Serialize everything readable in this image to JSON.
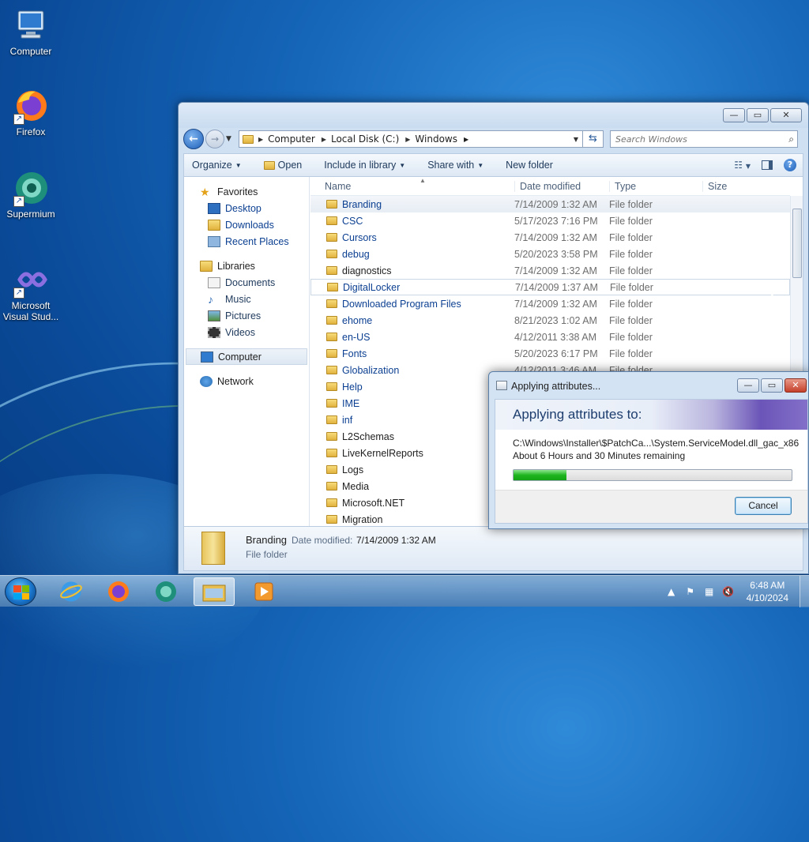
{
  "desktop": {
    "icons": [
      {
        "label": "Computer",
        "icon": "computer-icon"
      },
      {
        "label": "Firefox",
        "icon": "firefox-icon"
      },
      {
        "label": "Supermium",
        "icon": "supermium-icon"
      },
      {
        "label": "Microsoft Visual Stud...",
        "icon": "visual-studio-icon"
      }
    ]
  },
  "explorer": {
    "window_buttons": {
      "minimize": "—",
      "maximize": "▭",
      "close": "✕"
    },
    "breadcrumbs": [
      "Computer",
      "Local Disk (C:)",
      "Windows"
    ],
    "search_placeholder": "Search Windows",
    "toolbar": {
      "organize": "Organize",
      "open": "Open",
      "include_in_library": "Include in library",
      "share_with": "Share with",
      "new_folder": "New folder"
    },
    "nav": {
      "favorites": "Favorites",
      "desktop": "Desktop",
      "downloads": "Downloads",
      "recent_places": "Recent Places",
      "libraries": "Libraries",
      "documents": "Documents",
      "music": "Music",
      "pictures": "Pictures",
      "videos": "Videos",
      "computer": "Computer",
      "network": "Network"
    },
    "columns": {
      "name": "Name",
      "date_modified": "Date modified",
      "type": "Type",
      "size": "Size"
    },
    "files": [
      {
        "name": "Branding",
        "date": "7/14/2009 1:32 AM",
        "type": "File folder"
      },
      {
        "name": "CSC",
        "date": "5/17/2023 7:16 PM",
        "type": "File folder"
      },
      {
        "name": "Cursors",
        "date": "7/14/2009 1:32 AM",
        "type": "File folder"
      },
      {
        "name": "debug",
        "date": "5/20/2023 3:58 PM",
        "type": "File folder"
      },
      {
        "name": "diagnostics",
        "date": "7/14/2009 1:32 AM",
        "type": "File folder"
      },
      {
        "name": "DigitalLocker",
        "date": "7/14/2009 1:37 AM",
        "type": "File folder"
      },
      {
        "name": "Downloaded Program Files",
        "date": "7/14/2009 1:32 AM",
        "type": "File folder"
      },
      {
        "name": "ehome",
        "date": "8/21/2023 1:02 AM",
        "type": "File folder"
      },
      {
        "name": "en-US",
        "date": "4/12/2011 3:38 AM",
        "type": "File folder"
      },
      {
        "name": "Fonts",
        "date": "5/20/2023 6:17 PM",
        "type": "File folder"
      },
      {
        "name": "Globalization",
        "date": "4/12/2011 3:46 AM",
        "type": "File folder"
      },
      {
        "name": "Help",
        "date": "",
        "type": ""
      },
      {
        "name": "IME",
        "date": "",
        "type": ""
      },
      {
        "name": "inf",
        "date": "",
        "type": ""
      },
      {
        "name": "L2Schemas",
        "date": "",
        "type": ""
      },
      {
        "name": "LiveKernelReports",
        "date": "",
        "type": ""
      },
      {
        "name": "Logs",
        "date": "",
        "type": ""
      },
      {
        "name": "Media",
        "date": "",
        "type": ""
      },
      {
        "name": "Microsoft.NET",
        "date": "",
        "type": ""
      },
      {
        "name": "Migration",
        "date": "",
        "type": ""
      }
    ],
    "details": {
      "name": "Branding",
      "date_label": "Date modified:",
      "date_value": "7/14/2009 1:32 AM",
      "type": "File folder"
    }
  },
  "dialog": {
    "title": "Applying attributes...",
    "heading": "Applying attributes to:",
    "path": "C:\\Windows\\Installer\\$PatchCa...\\System.ServiceModel.dll_gac_x86",
    "remaining": "About 6 Hours and 30 Minutes remaining",
    "progress_fraction": 0.19,
    "cancel": "Cancel"
  },
  "taskbar": {
    "clock_time": "6:48 AM",
    "clock_date": "4/10/2024"
  }
}
